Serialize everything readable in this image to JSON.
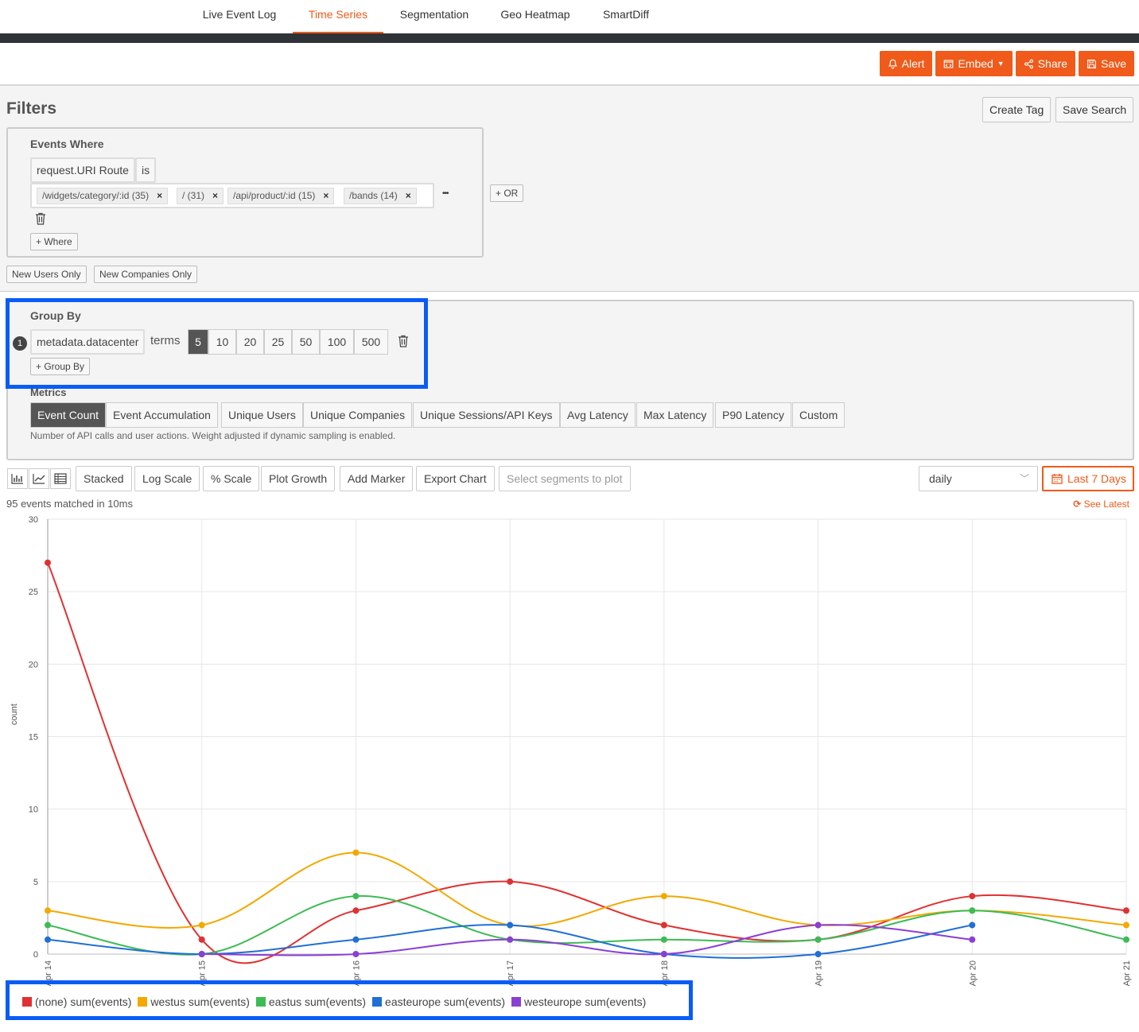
{
  "nav": {
    "tabs": [
      {
        "label": "Live Event Log"
      },
      {
        "label": "Time Series"
      },
      {
        "label": "Segmentation"
      },
      {
        "label": "Geo Heatmap"
      },
      {
        "label": "SmartDiff"
      }
    ],
    "active_tab": "Time Series"
  },
  "actions": {
    "alert": "Alert",
    "embed": "Embed",
    "share": "Share",
    "save": "Save"
  },
  "filters": {
    "title": "Filters",
    "create_tag": "Create Tag",
    "save_search": "Save Search",
    "events_where": "Events Where",
    "field": "request.URI Route",
    "operator": "is",
    "tags": [
      "/widgets/category/:id (35)",
      "/ (31)",
      "/api/product/:id (15)",
      "/bands (14)"
    ],
    "tag_close": "×",
    "more": "•••",
    "or_button": "+ OR",
    "where_button": "+ Where",
    "new_users": "New Users Only",
    "new_companies": "New Companies Only"
  },
  "group_by": {
    "title": "Group By",
    "index": "1",
    "field": "metadata.datacenter",
    "terms_label": "terms",
    "terms": [
      "5",
      "10",
      "20",
      "25",
      "50",
      "100",
      "500"
    ],
    "active_term": "5",
    "add_button": "+ Group By"
  },
  "metrics": {
    "title": "Metrics",
    "items": [
      "Event Count",
      "Event Accumulation",
      "Unique Users",
      "Unique Companies",
      "Unique Sessions/API Keys",
      "Avg Latency",
      "Max Latency",
      "P90 Latency",
      "Custom"
    ],
    "active": "Event Count",
    "description": "Number of API calls and user actions. Weight adjusted if dynamic sampling is enabled."
  },
  "toolbar": {
    "stacked": "Stacked",
    "log_scale": "Log Scale",
    "pct_scale": "% Scale",
    "plot_growth": "Plot Growth",
    "add_marker": "Add Marker",
    "export_chart": "Export Chart",
    "segments_placeholder": "Select segments to plot",
    "interval": "daily",
    "date_range": "Last 7 Days",
    "matched": "95 events matched in 10ms",
    "see_latest": "See Latest"
  },
  "chart_data": {
    "type": "line",
    "ylabel": "count",
    "ylim": [
      0,
      30
    ],
    "yticks": [
      "0",
      "5",
      "10",
      "15",
      "20",
      "25",
      "30"
    ],
    "categories": [
      "Apr 14",
      "Apr 15",
      "Apr 16",
      "Apr 17",
      "Apr 18",
      "Apr 19",
      "Apr 20",
      "Apr 21"
    ],
    "series": [
      {
        "name": "(none) sum(events)",
        "color": "#e03131",
        "values": [
          27,
          1,
          3,
          5,
          2,
          1,
          4,
          3
        ]
      },
      {
        "name": "westus sum(events)",
        "color": "#f2a900",
        "values": [
          3,
          2,
          7,
          2,
          4,
          2,
          3,
          2
        ]
      },
      {
        "name": "eastus sum(events)",
        "color": "#3dbb54",
        "values": [
          2,
          0,
          4,
          1,
          1,
          1,
          3,
          1
        ]
      },
      {
        "name": "easteurope sum(events)",
        "color": "#1f6fd6",
        "values": [
          1,
          0,
          1,
          2,
          0,
          0,
          2,
          null
        ]
      },
      {
        "name": "westeurope sum(events)",
        "color": "#8a3fd4",
        "values": [
          null,
          0,
          0,
          1,
          0,
          2,
          1,
          null
        ]
      }
    ],
    "grid": true,
    "legend": "bottom-left"
  }
}
